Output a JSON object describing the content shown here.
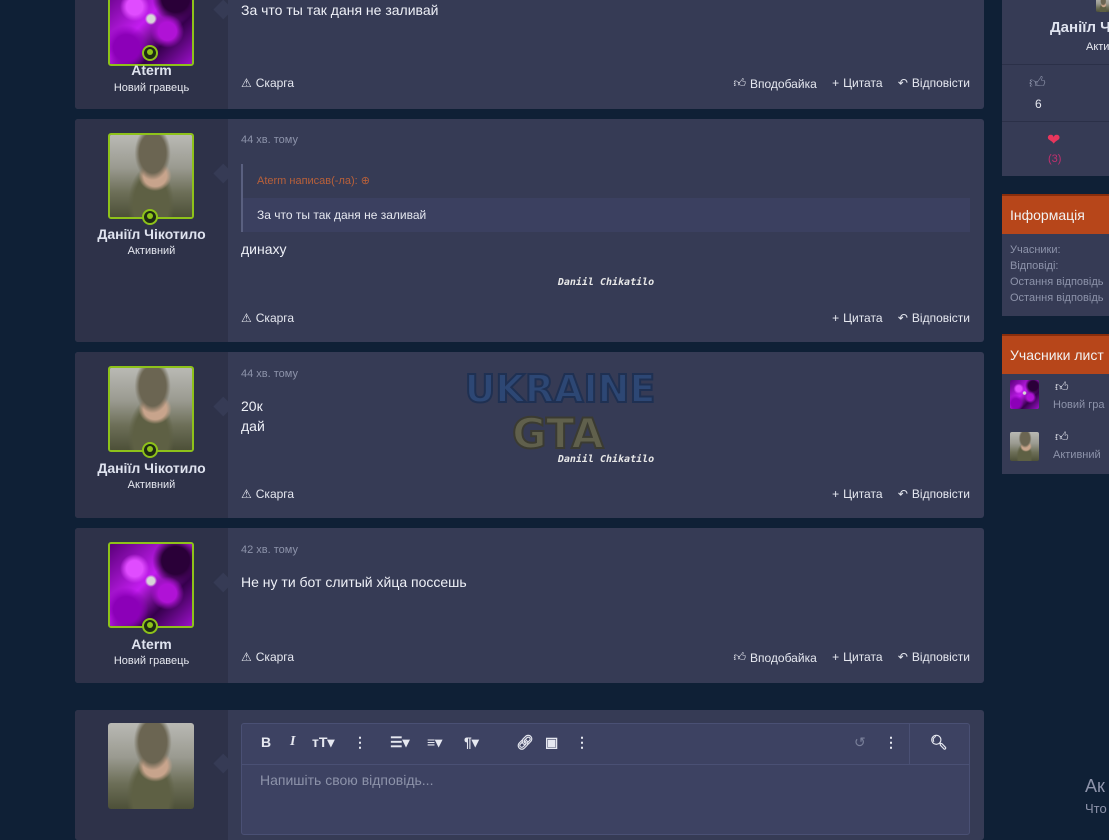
{
  "posts": [
    {
      "author": "Aterm",
      "user_title": "Новий гравець",
      "message": "За что ты так даня не заливай",
      "actions": {
        "report": "Скарга",
        "like": "Вподобайка",
        "quote": "Цитата",
        "reply": "Відповісти"
      }
    },
    {
      "author": "Даніїл Чікотило",
      "user_title": "Активний",
      "timestamp": "44 хв. тому",
      "quote_header": "Aterm написав(-ла):",
      "quote_body": "За что ты так даня не заливай",
      "message": "динаху",
      "signature": "Daniil Chikatilo",
      "actions": {
        "report": "Скарга",
        "quote": "Цитата",
        "reply": "Відповісти"
      }
    },
    {
      "author": "Даніїл Чікотило",
      "user_title": "Активний",
      "timestamp": "44 хв. тому",
      "message_line1": "20к",
      "message_line2": "дай",
      "signature": "Daniil Chikatilo",
      "actions": {
        "report": "Скарга",
        "quote": "Цитата",
        "reply": "Відповісти"
      }
    },
    {
      "author": "Aterm",
      "user_title": "Новий гравець",
      "timestamp": "42 хв. тому",
      "message": "Не ну ти бот слитый хйца поссешь",
      "actions": {
        "report": "Скарга",
        "like": "Вподобайка",
        "quote": "Цитата",
        "reply": "Відповісти"
      }
    }
  ],
  "watermark": {
    "line1": "UKRAINE",
    "line2": "GTA"
  },
  "editor": {
    "placeholder": "Напишіть свою відповідь...",
    "toolbar_icons": [
      "bold-icon",
      "italic-icon",
      "text-size-icon",
      "more-icon",
      "list-icon",
      "align-icon",
      "paragraph-icon",
      "link-icon",
      "image-icon",
      "more-icon",
      "undo-icon",
      "more-icon",
      "preview-icon"
    ]
  },
  "sidebar": {
    "user_card": {
      "name": "Даніїл Ч",
      "status": "Акти",
      "likes": "6",
      "reactions": "(3)"
    },
    "info": {
      "title": "Інформація",
      "rows": [
        "Учасники:",
        "Відповіді:",
        "Остання відповідь",
        "Остання відповідь"
      ]
    },
    "participants": {
      "title": "Учасники лист",
      "items": [
        {
          "subtitle": "Новий гра"
        },
        {
          "subtitle": "Активний"
        }
      ]
    }
  },
  "corner": {
    "line1": "Ак",
    "line2": "Что"
  },
  "colors": {
    "accent": "#b7461a",
    "online": "#8ec21a",
    "background": "#0f2036",
    "post_bg": "#363b55"
  }
}
